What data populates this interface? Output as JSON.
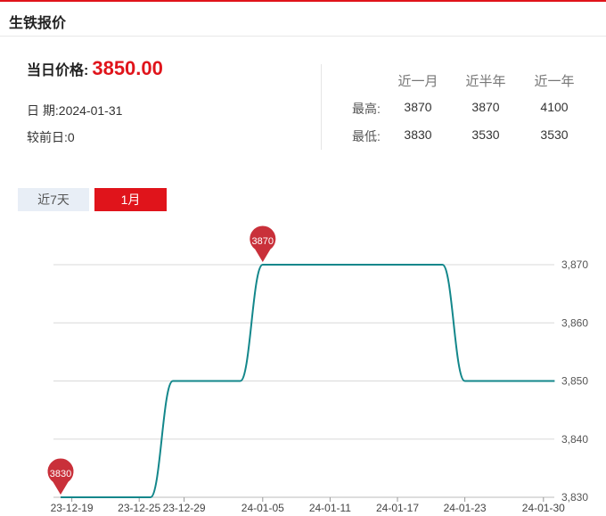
{
  "header": {
    "title": "生铁报价"
  },
  "price": {
    "label": "当日价格:",
    "value": "3850.00",
    "date_row": "日 期:2024-01-31",
    "change_row": "较前日:0"
  },
  "stats": {
    "columns": [
      "近一月",
      "近半年",
      "近一年"
    ],
    "rows": [
      {
        "label": "最高:",
        "values": [
          "3870",
          "3870",
          "4100"
        ]
      },
      {
        "label": "最低:",
        "values": [
          "3830",
          "3530",
          "3530"
        ]
      }
    ]
  },
  "tabs": [
    {
      "label": "近7天",
      "active": false
    },
    {
      "label": "1月",
      "active": true
    }
  ],
  "colors": {
    "accent": "#e0141b",
    "line": "#13878b",
    "marker": "#c9303a",
    "tab_inactive": "#e8eef6"
  },
  "chart_data": {
    "type": "line",
    "x_tick_labels": [
      "23-12-19",
      "23-12-25",
      "23-12-29",
      "24-01-05",
      "24-01-11",
      "24-01-17",
      "24-01-23",
      "24-01-30"
    ],
    "y_tick_labels": [
      "3,830",
      "3,840",
      "3,850",
      "3,860",
      "3,870"
    ],
    "ylim": [
      3830,
      3870
    ],
    "grid": true,
    "series": [
      {
        "points": [
          {
            "x": "2023-12-18",
            "y": 3830
          },
          {
            "x": "2023-12-26",
            "y": 3830
          },
          {
            "x": "2023-12-28",
            "y": 3850
          },
          {
            "x": "2024-01-03",
            "y": 3850
          },
          {
            "x": "2024-01-05",
            "y": 3870
          },
          {
            "x": "2024-01-21",
            "y": 3870
          },
          {
            "x": "2024-01-23",
            "y": 3850
          },
          {
            "x": "2024-01-31",
            "y": 3850
          }
        ]
      }
    ],
    "annotations": [
      {
        "label": "3830",
        "x": "2023-12-18",
        "y": 3830
      },
      {
        "label": "3870",
        "x": "2024-01-05",
        "y": 3870
      }
    ]
  }
}
